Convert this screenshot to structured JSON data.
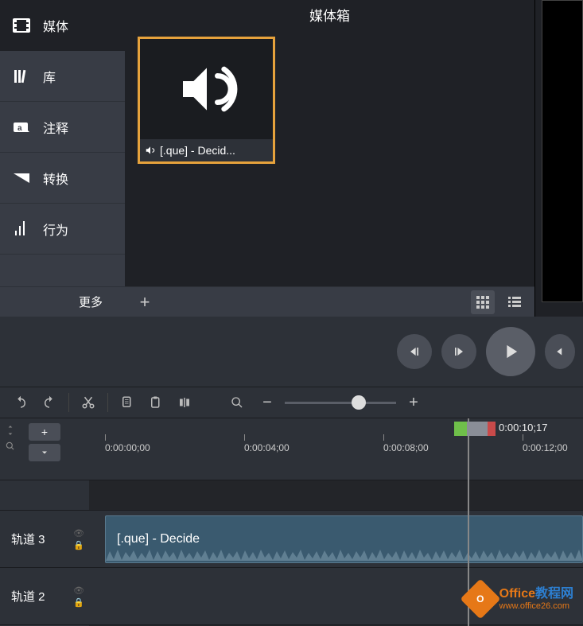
{
  "sidebar": {
    "items": [
      {
        "label": "媒体",
        "icon": "media"
      },
      {
        "label": "库",
        "icon": "library"
      },
      {
        "label": "注释",
        "icon": "annotation"
      },
      {
        "label": "转换",
        "icon": "transition"
      },
      {
        "label": "行为",
        "icon": "behavior"
      }
    ],
    "more": "更多"
  },
  "bin": {
    "title": "媒体箱",
    "item_label": "[.que]   - Decid...",
    "add": "+"
  },
  "playhead_time": "0:00:10;17",
  "ruler_ticks": [
    "0:00:00;00",
    "0:00:04;00",
    "0:00:08;00",
    "0:00:12;00"
  ],
  "tracks": [
    {
      "label": "轨道 3"
    },
    {
      "label": "轨道 2"
    }
  ],
  "clip_label": "[.que]    - Decide",
  "watermark": {
    "title_a": "Office",
    "title_b": "教程网",
    "url": "www.office26.com"
  }
}
